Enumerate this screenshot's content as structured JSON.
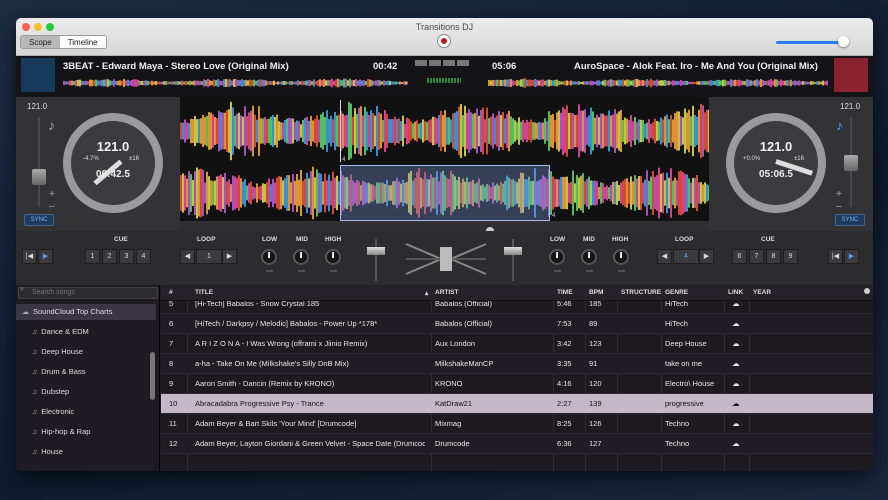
{
  "window": {
    "title": "Transitions DJ"
  },
  "modes": [
    {
      "label": "Scope",
      "active": true
    },
    {
      "label": "Timeline",
      "active": false
    }
  ],
  "deck_left": {
    "track_title": "3BEAT - Edward Maya - Stereo Love (Original Mix)",
    "remaining": "00:42",
    "bpm_small": "121.0",
    "bpm": "121.0",
    "time": "00:42.5",
    "pitch_pct": "-4.7%",
    "pitch_range": "±16",
    "sync_label": "SYNC",
    "plus": "+",
    "minus": "–",
    "color": "#173a5a"
  },
  "deck_right": {
    "track_title": "AuroSpace - Alok Feat. Iro - Me And You (Original Mix)",
    "remaining": "05:06",
    "bpm_small": "121.0",
    "bpm": "121.0",
    "time": "05:06.5",
    "pitch_pct": "+0.0%",
    "pitch_range": "±16",
    "sync_label": "SYNC",
    "plus": "+",
    "minus": "–",
    "color": "#8a2230"
  },
  "wave_markers": {
    "left": "4",
    "right": "4"
  },
  "controls": {
    "cue_label": "CUE",
    "loop_label": "LOOP",
    "low_label": "LOW",
    "mid_label": "MID",
    "high_label": "HIGH",
    "left_cues": [
      "1",
      "2",
      "3",
      "4"
    ],
    "right_cues": [
      "6",
      "7",
      "8",
      "9"
    ],
    "left_loop": "1",
    "right_loop": "4",
    "transport_prev": "|◀",
    "transport_play": "▶",
    "loop_prev": "◀",
    "loop_next": "▶",
    "knob_tick": "=="
  },
  "sidebar": {
    "search_placeholder": "Search songs",
    "root": "SoundCloud Top Charts",
    "items": [
      "Dance & EDM",
      "Deep House",
      "Drum & Bass",
      "Dubstep",
      "Electronic",
      "Hip-hop & Rap",
      "House"
    ]
  },
  "table": {
    "headers": {
      "num": "#",
      "title": "TITLE",
      "artist": "ARTIST",
      "time": "TIME",
      "bpm": "BPM",
      "structure": "STRUCTURE",
      "genre": "GENRE",
      "link": "LINK",
      "year": "YEAR"
    },
    "rows": [
      {
        "num": "5",
        "title": "[Hi-Tech] Babalos - Snow Crystal 185",
        "artist": "Babalos (Official)",
        "time": "5:46",
        "bpm": "185",
        "genre": "HiTech",
        "link": "☁"
      },
      {
        "num": "6",
        "title": "[HiTech / Darkpsy / Melodic] Babalos - Power Up *178*",
        "artist": "Babalos (Official)",
        "time": "7:53",
        "bpm": "89",
        "genre": "HiTech",
        "link": "☁"
      },
      {
        "num": "7",
        "title": "A R I Z O N A - I Was Wrong (offrami x Jiinio Remix)",
        "artist": "Aux London",
        "time": "3:42",
        "bpm": "123",
        "genre": "Deep House",
        "link": "☁"
      },
      {
        "num": "8",
        "title": "a-ha - Take On Me (Milkshake's Silly DnB Mix)",
        "artist": "MilkshakeManCP",
        "time": "3:35",
        "bpm": "91",
        "genre": "take on me",
        "link": "☁"
      },
      {
        "num": "9",
        "title": "Aaron Smith - Dancin (Remix by KRONO)",
        "artist": "KRONO",
        "time": "4:16",
        "bpm": "120",
        "genre": "Electro\\ House",
        "link": "☁"
      },
      {
        "num": "10",
        "title": "Abracadabra Progressive Psy - Trance",
        "artist": "KatDraw21",
        "time": "2:27",
        "bpm": "139",
        "genre": "progressive",
        "link": "☁"
      },
      {
        "num": "11",
        "title": "Adam Beyer & Bart Skils 'Your Mind' [Drumcode]",
        "artist": "Mixmag",
        "time": "8:25",
        "bpm": "126",
        "genre": "Techno",
        "link": "☁"
      },
      {
        "num": "12",
        "title": "Adam Beyer, Layton Giordani & Green Velvet - Space Date (Drumcode)",
        "artist": "Drumcode",
        "time": "6:36",
        "bpm": "127",
        "genre": "Techno",
        "link": "☁"
      }
    ],
    "selected_index": 5
  }
}
